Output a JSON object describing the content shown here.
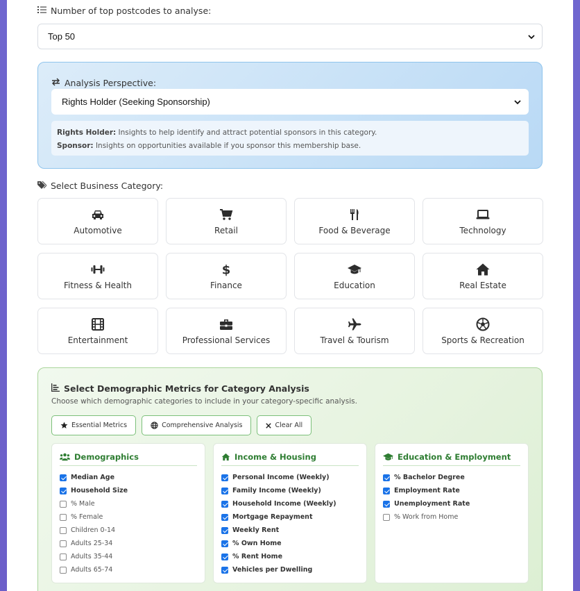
{
  "postcodes": {
    "label": "Number of top postcodes to analyse:",
    "selected": "Top 50"
  },
  "perspective": {
    "label": "Analysis Perspective:",
    "selected": "Rights Holder (Seeking Sponsorship)",
    "info": [
      {
        "term": "Rights Holder:",
        "text": " Insights to help identify and attract potential sponsors in this category."
      },
      {
        "term": "Sponsor:",
        "text": " Insights on opportunities available if you sponsor this membership base."
      }
    ]
  },
  "category": {
    "label": "Select Business Category:",
    "items": [
      {
        "label": "Automotive",
        "icon": "car-icon"
      },
      {
        "label": "Retail",
        "icon": "shopping-cart-icon"
      },
      {
        "label": "Food & Beverage",
        "icon": "utensils-icon"
      },
      {
        "label": "Technology",
        "icon": "laptop-icon"
      },
      {
        "label": "Fitness & Health",
        "icon": "dumbbell-icon"
      },
      {
        "label": "Finance",
        "icon": "dollar-icon"
      },
      {
        "label": "Education",
        "icon": "graduation-cap-icon"
      },
      {
        "label": "Real Estate",
        "icon": "home-icon"
      },
      {
        "label": "Entertainment",
        "icon": "film-icon"
      },
      {
        "label": "Professional Services",
        "icon": "briefcase-icon"
      },
      {
        "label": "Travel & Tourism",
        "icon": "plane-icon"
      },
      {
        "label": "Sports & Recreation",
        "icon": "football-icon"
      }
    ]
  },
  "metrics": {
    "title": "Select Demographic Metrics for Category Analysis",
    "subtitle": "Choose which demographic categories to include in your category-specific analysis.",
    "buttons": {
      "essential": "Essential Metrics",
      "comprehensive": "Comprehensive Analysis",
      "clear": "Clear All"
    },
    "groups": [
      {
        "title": "Demographics",
        "items": [
          {
            "label": "Median Age",
            "checked": true
          },
          {
            "label": "Household Size",
            "checked": true
          },
          {
            "label": "% Male",
            "checked": false
          },
          {
            "label": "% Female",
            "checked": false
          },
          {
            "label": "Children 0-14",
            "checked": false
          },
          {
            "label": "Adults 25-34",
            "checked": false
          },
          {
            "label": "Adults 35-44",
            "checked": false
          },
          {
            "label": "Adults 65-74",
            "checked": false
          }
        ]
      },
      {
        "title": "Income & Housing",
        "items": [
          {
            "label": "Personal Income (Weekly)",
            "checked": true
          },
          {
            "label": "Family Income (Weekly)",
            "checked": true
          },
          {
            "label": "Household Income (Weekly)",
            "checked": true
          },
          {
            "label": "Mortgage Repayment",
            "checked": true
          },
          {
            "label": "Weekly Rent",
            "checked": true
          },
          {
            "label": "% Own Home",
            "checked": true
          },
          {
            "label": "% Rent Home",
            "checked": true
          },
          {
            "label": "Vehicles per Dwelling",
            "checked": true
          }
        ]
      },
      {
        "title": "Education & Employment",
        "items": [
          {
            "label": "% Bachelor Degree",
            "checked": true
          },
          {
            "label": "Employment Rate",
            "checked": true
          },
          {
            "label": "Unemployment Rate",
            "checked": true
          },
          {
            "label": "% Work from Home",
            "checked": false
          }
        ]
      }
    ]
  },
  "colors": {
    "background": "#6f66cf",
    "perspective_bg": "#c9e2f7",
    "metrics_bg": "#e6f3df",
    "accent_green": "#2e7d32",
    "checkbox_blue": "#1a73e8"
  }
}
